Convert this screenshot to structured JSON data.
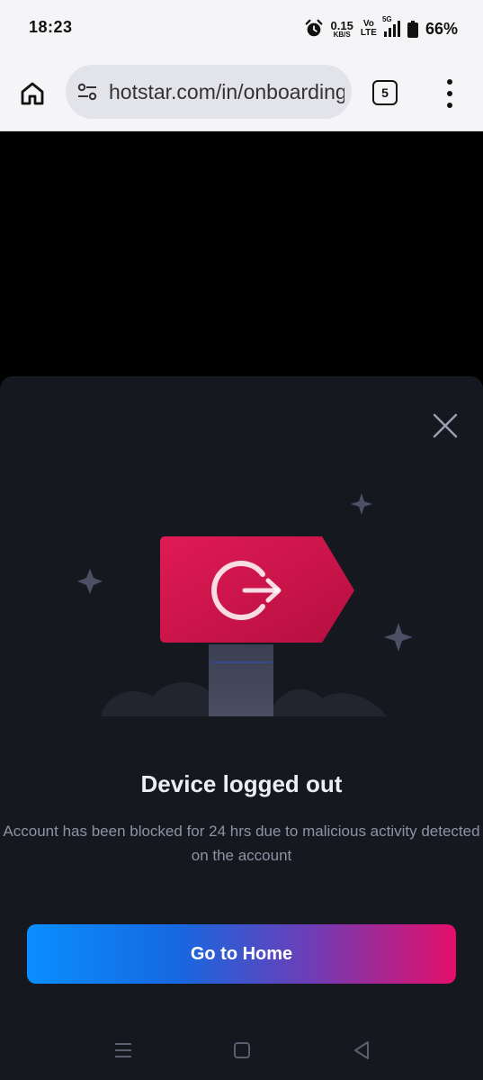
{
  "status_bar": {
    "time": "18:23",
    "net_speed": "0.15",
    "net_speed_unit": "KB/S",
    "volte_top": "Vo",
    "volte_bottom": "LTE",
    "network_type": "5G",
    "battery_percent": "66%"
  },
  "browser": {
    "url": "hotstar.com/in/onboarding",
    "tab_count": "5"
  },
  "dialog": {
    "title": "Device logged out",
    "message": "Account has been blocked for 24 hrs due to malicious activity detected on the account",
    "cta_label": "Go to Home"
  },
  "colors": {
    "sheet_bg": "#16181f",
    "sign_red": "#d4164e",
    "cta_gradient_start": "#0a8fff",
    "cta_gradient_end": "#e40e6a"
  },
  "icons": {
    "home": "home-icon",
    "site_settings": "tune-icon",
    "tabs": "tabs-icon",
    "menu": "more-vert-icon",
    "close": "close-icon",
    "logout": "logout-icon"
  }
}
